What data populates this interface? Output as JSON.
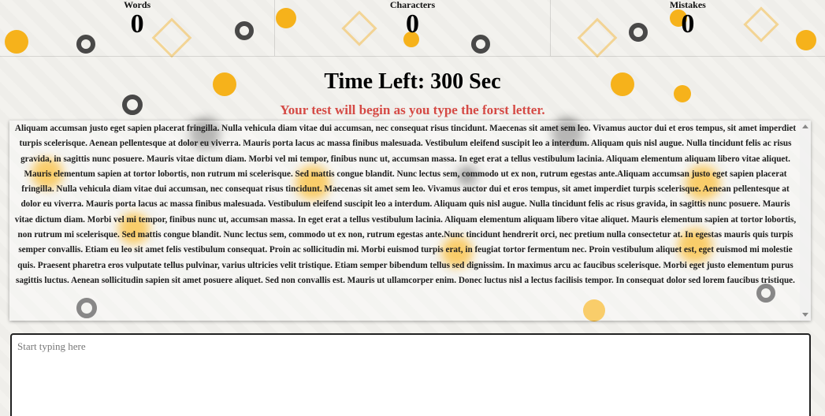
{
  "stats": {
    "words_label": "Words",
    "words_value": "0",
    "characters_label": "Characters",
    "characters_value": "0",
    "mistakes_label": "Mistakes",
    "mistakes_value": "0"
  },
  "timer": {
    "text": "Time Left: 300 Sec"
  },
  "notice": {
    "text": "Your test will begin as you type the forst letter."
  },
  "passage": {
    "text": "Aliquam accumsan justo eget sapien placerat fringilla. Nulla vehicula diam vitae dui accumsan, nec consequat risus tincidunt. Maecenas sit amet sem leo. Vivamus auctor dui et eros tempus, sit amet imperdiet turpis scelerisque. Aenean pellentesque at dolor eu viverra. Mauris porta lacus ac massa finibus malesuada. Vestibulum eleifend suscipit leo a interdum. Aliquam quis nisl augue. Nulla tincidunt felis ac risus gravida, in sagittis nunc posuere. Mauris vitae dictum diam. Morbi vel mi tempor, finibus nunc ut, accumsan massa. In eget erat a tellus vestibulum lacinia. Aliquam elementum aliquam libero vitae aliquet. Mauris elementum sapien at tortor lobortis, non rutrum mi scelerisque. Sed mattis congue blandit. Nunc lectus sem, commodo ut ex non, rutrum egestas ante.Aliquam accumsan justo eget sapien placerat fringilla. Nulla vehicula diam vitae dui accumsan, nec consequat risus tincidunt. Maecenas sit amet sem leo. Vivamus auctor dui et eros tempus, sit amet imperdiet turpis scelerisque. Aenean pellentesque at dolor eu viverra. Mauris porta lacus ac massa finibus malesuada. Vestibulum eleifend suscipit leo a interdum. Aliquam quis nisl augue. Nulla tincidunt felis ac risus gravida, in sagittis nunc posuere. Mauris vitae dictum diam. Morbi vel mi tempor, finibus nunc ut, accumsan massa. In eget erat a tellus vestibulum lacinia. Aliquam elementum aliquam libero vitae aliquet. Mauris elementum sapien at tortor lobortis, non rutrum mi scelerisque. Sed mattis congue blandit. Nunc lectus sem, commodo ut ex non, rutrum egestas ante.Nunc tincidunt hendrerit orci, nec pretium nulla consectetur at. In egestas mauris quis turpis semper convallis. Etiam eu leo sit amet felis vestibulum consequat. Proin ac sollicitudin mi. Morbi euismod turpis erat, in feugiat tortor fermentum nec. Proin vestibulum aliquet est, eget euismod mi molestie quis. Praesent pharetra eros vulputate tellus pulvinar, varius ultricies velit tristique. Etiam semper bibendum tellus sed dignissim. In maximus arcu ac faucibus scelerisque. Morbi eget justo elementum purus sagittis luctus. Aenean sollicitudin sapien sit amet posuere aliquet. Sed non convallis est. Mauris ut ullamcorper enim. Donec luctus nisl a lectus facilisis tempor. In consequat dolor sed lorem faucibus tristique."
  },
  "input": {
    "placeholder": "Start typing here"
  },
  "colors": {
    "notice": "#d54a45",
    "accent_yellow": "#f6b21b",
    "ring_dark": "#2a2a2a"
  }
}
